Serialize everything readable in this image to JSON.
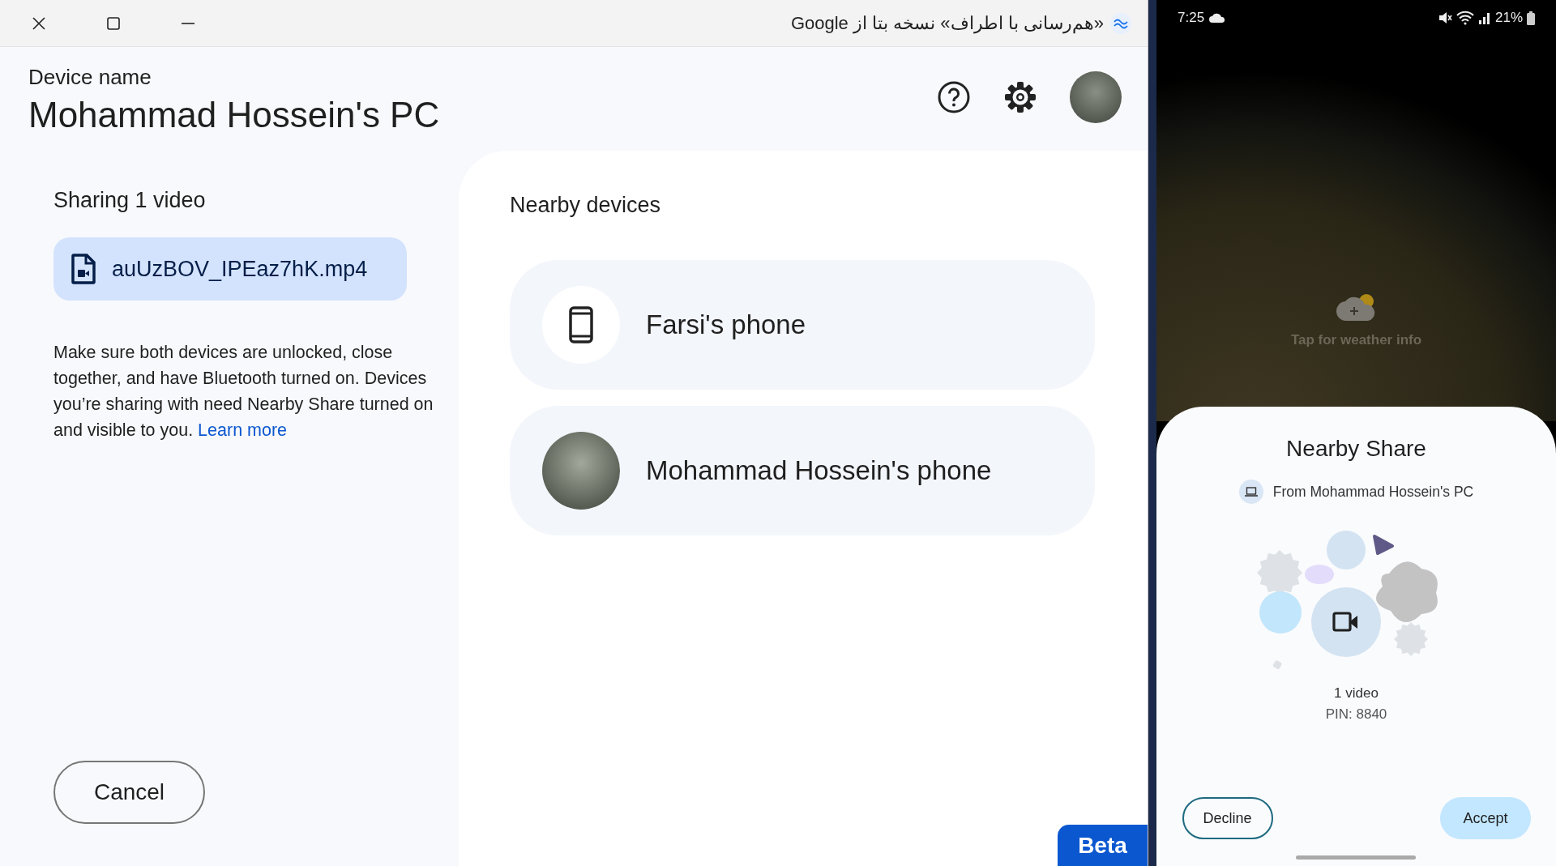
{
  "window": {
    "title": "«هم‌رسانی با اطراف» نسخه بتا از Google"
  },
  "device": {
    "label": "Device name",
    "name": "Mohammad Hossein's PC"
  },
  "sharing": {
    "heading": "Sharing 1 video",
    "file": "auUzBOV_IPEaz7hK.mp4",
    "note": "Make sure both devices are unlocked, close together, and have Bluetooth turned on. Devices you’re sharing with need Nearby Share turned on and visible to you.",
    "link": "Learn more",
    "cancel": "Cancel"
  },
  "nearby": {
    "heading": "Nearby devices",
    "devices": [
      {
        "name": "Farsi's phone",
        "kind": "phone"
      },
      {
        "name": "Mohammad Hossein's phone",
        "kind": "avatar"
      }
    ]
  },
  "badge": "Beta",
  "phone": {
    "status_bar": {
      "time": "7:25",
      "battery": "21%"
    },
    "weather": "Tap for weather info",
    "sheet": {
      "title": "Nearby Share",
      "from": "From Mohammad Hossein's PC",
      "count": "1 video",
      "pin": "PIN: 8840",
      "buttons": [
        {
          "label": "Decline",
          "kind": "outlined"
        },
        {
          "label": "Accept",
          "kind": "filled"
        }
      ]
    }
  }
}
